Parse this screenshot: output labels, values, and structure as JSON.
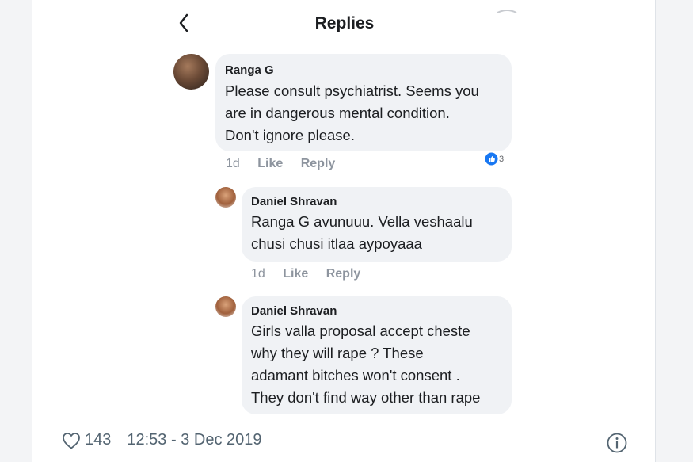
{
  "header": {
    "title": "Replies"
  },
  "comments": [
    {
      "name": "Ranga G",
      "lines": [
        "Please consult psychiatrist. Seems you",
        "are in dangerous mental condition.",
        "Don't ignore please."
      ],
      "time": "1d",
      "like": "Like",
      "reply": "Reply",
      "reaction_count": "3"
    },
    {
      "name": "Daniel Shravan",
      "lines": [
        "Ranga G avunuuu. Vella veshaalu",
        "chusi chusi itlaa aypoyaaa"
      ],
      "time": "1d",
      "like": "Like",
      "reply": "Reply"
    },
    {
      "name": "Daniel Shravan",
      "lines": [
        "Girls valla proposal accept cheste",
        "why they will rape ? These",
        "adamant bitches won't consent .",
        "They don't find way other than rape"
      ]
    }
  ],
  "tweet": {
    "likes": "143",
    "timestamp": "12:53 - 3 Dec 2019"
  },
  "colors": {
    "bubble": "#f0f2f5",
    "like_blue": "#1877f2",
    "meta_gray": "#8d949e"
  },
  "icons": [
    "back-arrow-icon",
    "like-reaction-icon",
    "heart-icon",
    "info-icon"
  ]
}
